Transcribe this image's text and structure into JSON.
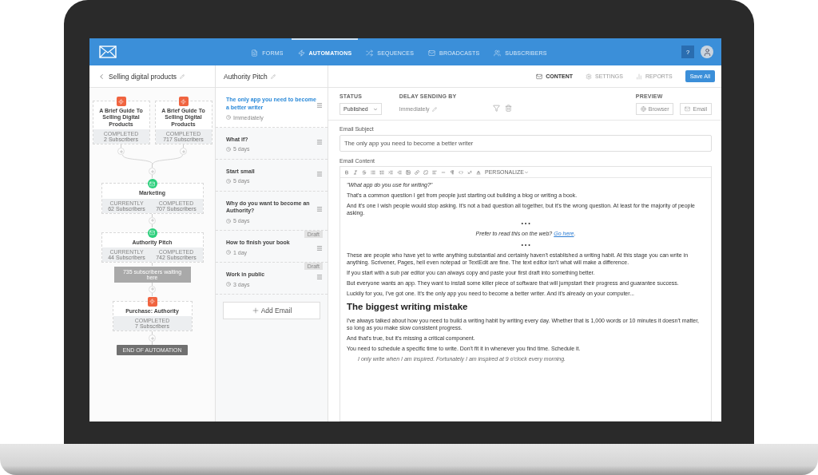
{
  "nav": {
    "items": [
      {
        "label": "FORMS",
        "selected": false
      },
      {
        "label": "AUTOMATIONS",
        "selected": true
      },
      {
        "label": "SEQUENCES",
        "selected": false
      },
      {
        "label": "BROADCASTS",
        "selected": false
      },
      {
        "label": "SUBSCRIBERS",
        "selected": false
      }
    ],
    "help": "?"
  },
  "automation": {
    "title": "Selling digital products"
  },
  "sequence": {
    "title": "Authority Pitch"
  },
  "view_tabs": [
    {
      "label": "CONTENT",
      "selected": true
    },
    {
      "label": "SETTINGS",
      "selected": false
    },
    {
      "label": "REPORTS",
      "selected": false
    }
  ],
  "save_button": "Save All",
  "flow": {
    "entry_nodes": [
      {
        "title": "A Brief Guide To Selling Digital Products",
        "stats": [
          {
            "label": "COMPLETED",
            "count": "2 Subscribers"
          }
        ]
      },
      {
        "title": "A Brief Guide To Selling Digital Products",
        "stats": [
          {
            "label": "COMPLETED",
            "count": "717 Subscribers"
          }
        ]
      }
    ],
    "steps": [
      {
        "kind": "plus"
      },
      {
        "kind": "sequence_node",
        "title": "Marketing",
        "stats": [
          {
            "label": "CURRENTLY",
            "count": "62 Subscribers"
          },
          {
            "label": "COMPLETED",
            "count": "707 Subscribers"
          }
        ]
      },
      {
        "kind": "plus"
      },
      {
        "kind": "sequence_node",
        "title": "Authority Pitch",
        "stats": [
          {
            "label": "CURRENTLY",
            "count": "44 Subscribers"
          },
          {
            "label": "COMPLETED",
            "count": "742 Subscribers"
          }
        ]
      },
      {
        "kind": "waiting",
        "text": "735 subscribers waiting here"
      },
      {
        "kind": "plus"
      },
      {
        "kind": "trigger_node",
        "title": "Purchase: Authority",
        "stats": [
          {
            "label": "COMPLETED",
            "count": "7 Subscribers"
          }
        ]
      },
      {
        "kind": "plus"
      },
      {
        "kind": "end",
        "text": "END OF AUTOMATION"
      }
    ]
  },
  "emails": [
    {
      "title": "The only app you need to become a better writer",
      "delay": "Immediately",
      "selected": true
    },
    {
      "title": "What if?",
      "delay": "5 days",
      "selected": false
    },
    {
      "title": "Start small",
      "delay": "5 days",
      "selected": false
    },
    {
      "title": "Why do you want to become an Authority?",
      "delay": "5 days",
      "selected": false
    },
    {
      "title": "How to finish your book",
      "delay": "1 day",
      "badge": "Draft",
      "selected": false
    },
    {
      "title": "Work in public",
      "delay": "3 days",
      "badge": "Draft",
      "selected": false
    }
  ],
  "add_email": "Add Email",
  "settings": {
    "status_label": "STATUS",
    "status_value": "Published",
    "delay_label": "DELAY SENDING BY",
    "delay_value": "Immediately",
    "preview_label": "PREVIEW",
    "preview_buttons": [
      "Browser",
      "Email"
    ]
  },
  "subject": {
    "label": "Email Subject",
    "value": "The only app you need to become a better writer"
  },
  "content": {
    "label": "Email Content",
    "personalize": "PERSONALIZE",
    "blocks": [
      {
        "kind": "italic",
        "text": "\"What app do you use for writing?\""
      },
      {
        "kind": "para",
        "text": "That's a common question I get from people just starting out building a blog or writing a book."
      },
      {
        "kind": "para",
        "text": "And it's one I wish people would stop asking. It's not a bad question all together, but it's the wrong question. At least for the majority of people asking."
      },
      {
        "kind": "separator",
        "text": "• • •"
      },
      {
        "kind": "link_line",
        "text": "Prefer to read this on the web?",
        "link": "Go here",
        "after": "."
      },
      {
        "kind": "separator",
        "text": "• • •"
      },
      {
        "kind": "para",
        "text": "These are people who have yet to write anything substantial and certainly haven't established a writing habit. At this stage you can write in anything. Scrivener, Pages, hell even notepad or TextEdit are fine. The text editor isn't what will make a difference."
      },
      {
        "kind": "para",
        "text": "If you start with a sub par editor you can always copy and paste your first draft into something better."
      },
      {
        "kind": "para",
        "text": "But everyone wants an app. They want to install some killer piece of software that will jumpstart their progress and guarantee success."
      },
      {
        "kind": "para",
        "text": "Luckily for you, I've got one. It's the only app you need to become a better writer. And it's already on your computer..."
      },
      {
        "kind": "heading",
        "text": "The biggest writing mistake"
      },
      {
        "kind": "para",
        "text": "I've always talked about how you need to build a writing habit by writing every day. Whether that is 1,000 words or 10 minutes it doesn't matter, so long as you make slow consistent progress."
      },
      {
        "kind": "para",
        "text": "And that's true, but it's missing a critical component."
      },
      {
        "kind": "para",
        "text": "You need to schedule a specific time to write. Don't fit it in whenever you find time. Schedule it."
      },
      {
        "kind": "quote",
        "text": "I only write when I am inspired. Fortunately I am inspired at 9 o'clock every morning."
      }
    ]
  }
}
